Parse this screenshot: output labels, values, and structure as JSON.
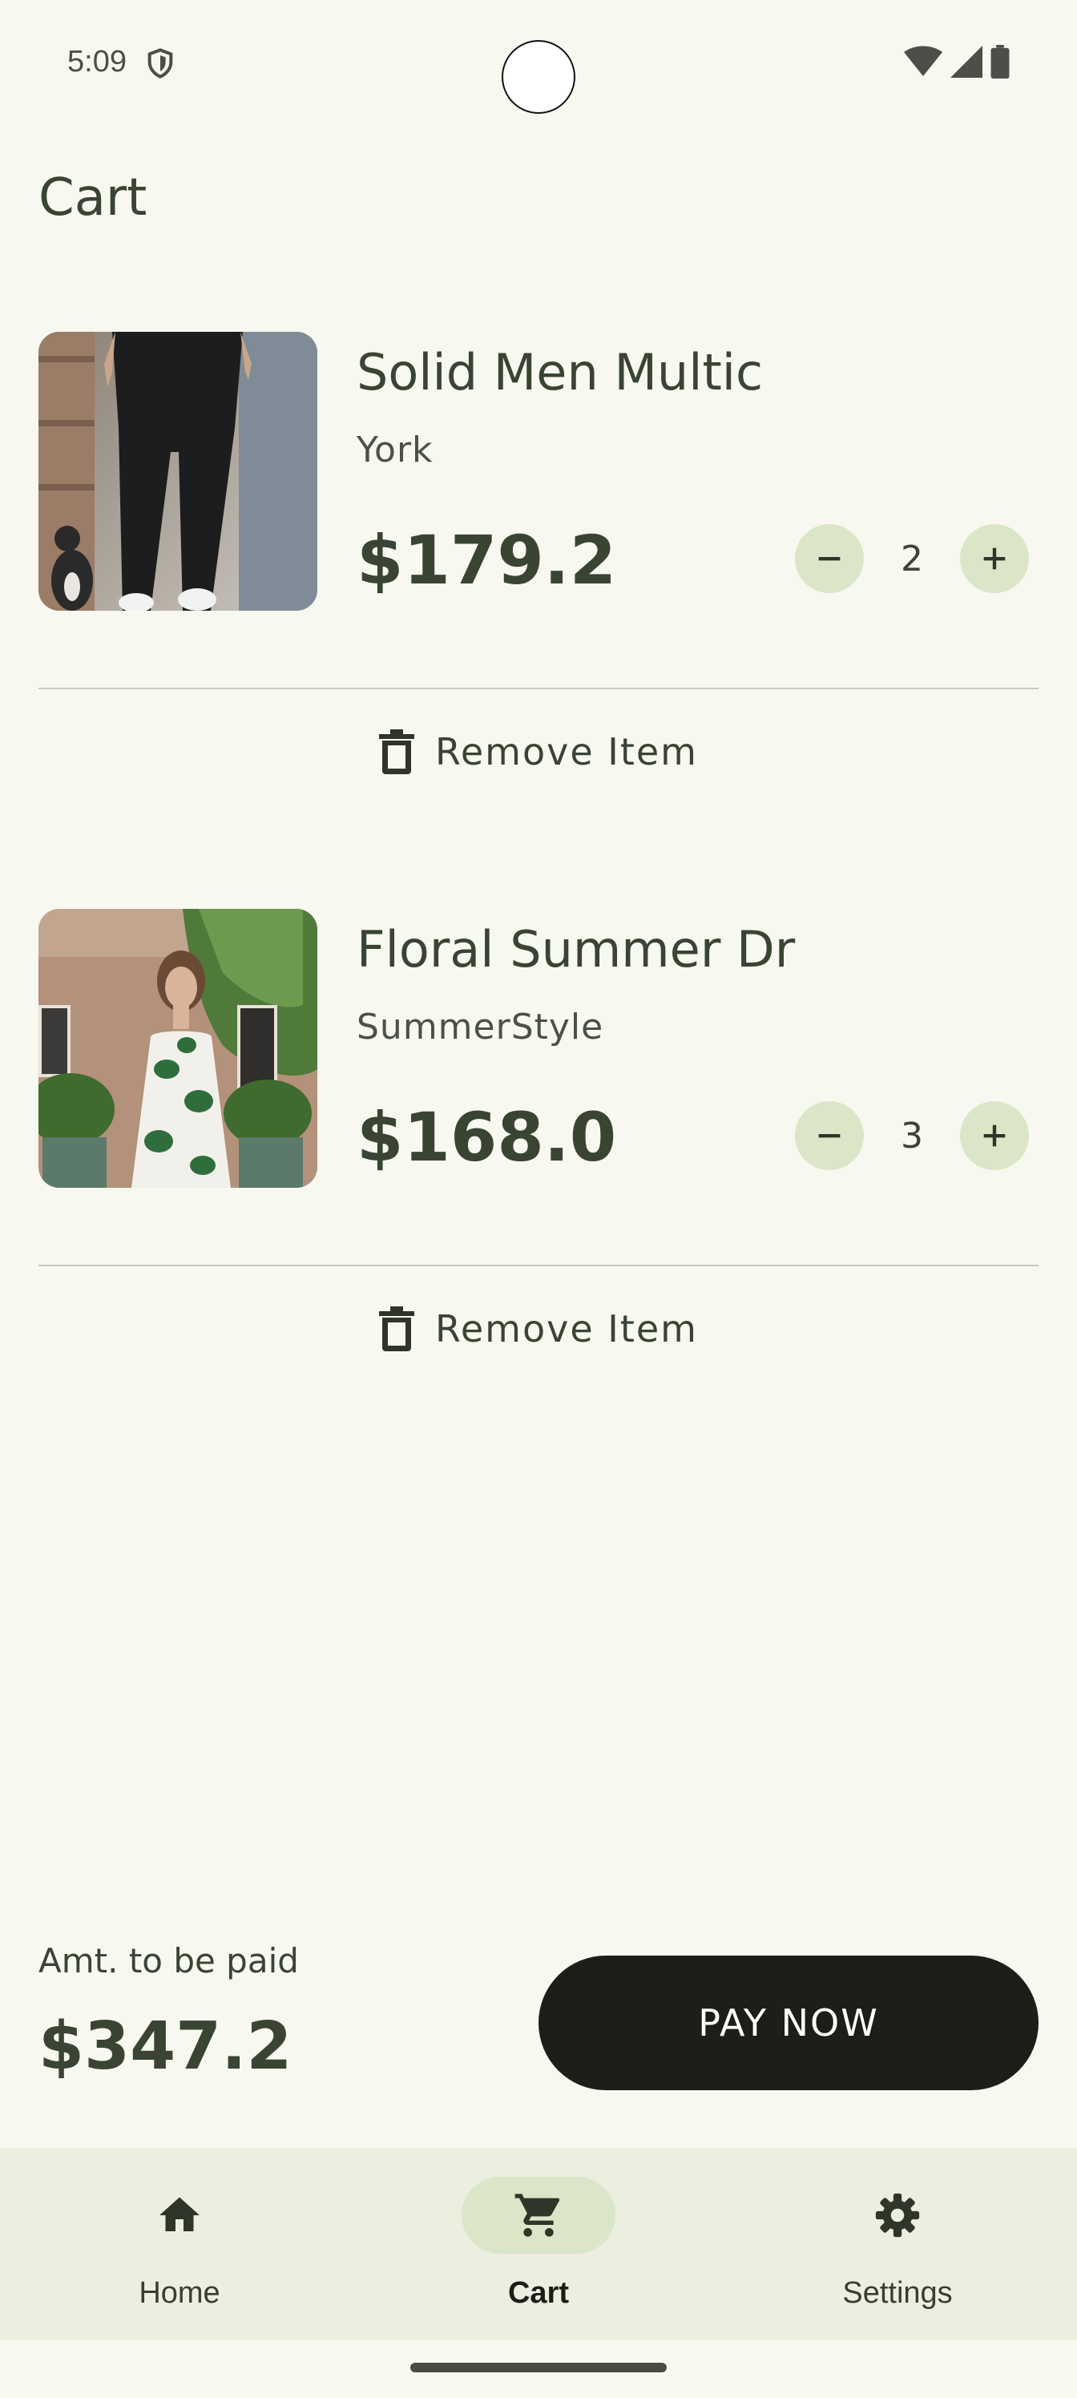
{
  "status_bar": {
    "time": "5:09"
  },
  "header": {
    "title": "Cart"
  },
  "items": [
    {
      "name": "Solid Men Multic",
      "brand": "York",
      "price": "$179.2",
      "quantity": "2",
      "remove_label": "Remove Item",
      "image": "black-trousers-product-photo"
    },
    {
      "name": "Floral Summer Dr",
      "brand": "SummerStyle",
      "price": "$168.0",
      "quantity": "3",
      "remove_label": "Remove Item",
      "image": "floral-dress-product-photo"
    }
  ],
  "summary": {
    "amount_label": "Amt. to be paid",
    "amount": "$347.2",
    "pay_label": "PAY NOW"
  },
  "nav": [
    {
      "label": "Home",
      "icon": "home-icon",
      "active": false
    },
    {
      "label": "Cart",
      "icon": "cart-icon",
      "active": true
    },
    {
      "label": "Settings",
      "icon": "gear-icon",
      "active": false
    }
  ],
  "colors": {
    "background": "#f7f8ef",
    "accent": "#dbe6c8",
    "text": "#3a4432",
    "button": "#1c1e17"
  }
}
